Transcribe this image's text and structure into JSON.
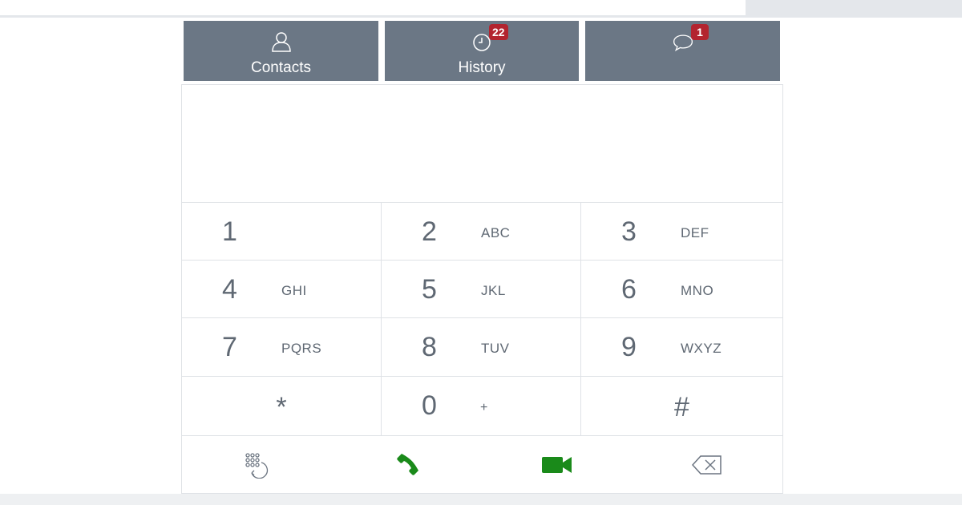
{
  "tabs": [
    {
      "label": "Contacts",
      "icon": "person-icon",
      "badge": null
    },
    {
      "label": "History",
      "icon": "clock-icon",
      "badge": "22"
    },
    {
      "label": "",
      "icon": "chat-bubble-icon",
      "badge": "1"
    }
  ],
  "dialer": {
    "number": "",
    "keys": [
      {
        "digit": "1",
        "letters": ""
      },
      {
        "digit": "2",
        "letters": "ABC"
      },
      {
        "digit": "3",
        "letters": "DEF"
      },
      {
        "digit": "4",
        "letters": "GHI"
      },
      {
        "digit": "5",
        "letters": "JKL"
      },
      {
        "digit": "6",
        "letters": "MNO"
      },
      {
        "digit": "7",
        "letters": "PQRS"
      },
      {
        "digit": "8",
        "letters": "TUV"
      },
      {
        "digit": "9",
        "letters": "WXYZ"
      },
      {
        "digit": "*",
        "letters": ""
      },
      {
        "digit": "0",
        "letters": "+"
      },
      {
        "digit": "#",
        "letters": ""
      }
    ]
  },
  "actions": [
    {
      "name": "keypad-redial-icon"
    },
    {
      "name": "phone-icon"
    },
    {
      "name": "video-camera-icon"
    },
    {
      "name": "backspace-icon"
    }
  ],
  "colors": {
    "tab_bg": "#6b7785",
    "badge": "#b3242f",
    "call_green": "#1a8a1a",
    "key_text": "#5f6873"
  }
}
